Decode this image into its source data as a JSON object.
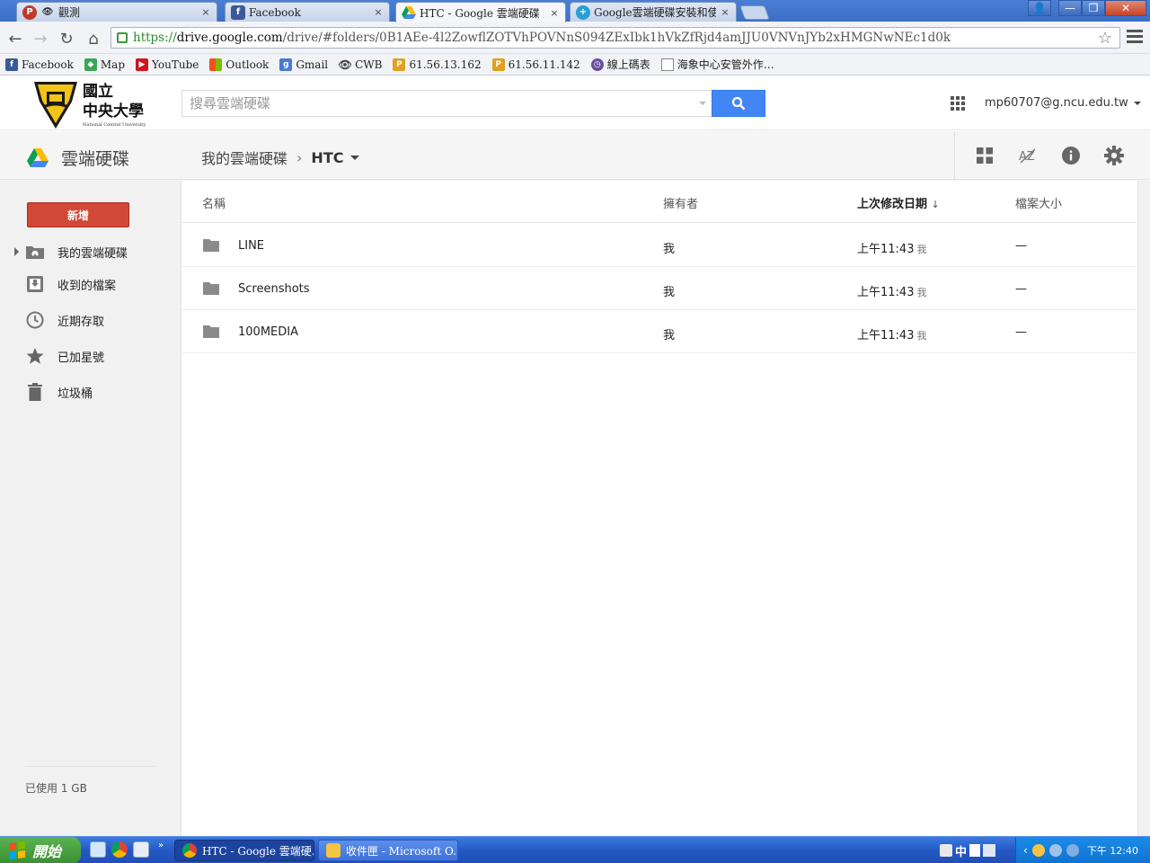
{
  "browser": {
    "tabs": [
      {
        "title": "觀測",
        "close": "×"
      },
      {
        "title": "Facebook",
        "close": "×"
      },
      {
        "title": "HTC - Google 雲端硬碟",
        "close": "×"
      },
      {
        "title": "Google雲端硬碟安裝和使用",
        "close": "×"
      }
    ],
    "url": {
      "scheme": "https://",
      "host": "drive.google.com",
      "path": "/drive/#folders/0B1AEe-4l2ZowflZOTVhPOVNnS094ZExIbk1hVkZfRjd4amJJU0VNVnJYb2xHMGNwNEc1d0k"
    },
    "bookmarks": [
      {
        "label": "Facebook",
        "icon": "facebook-icon",
        "color": "#3b5998"
      },
      {
        "label": "Map",
        "icon": "map-icon",
        "color": "#3aa757"
      },
      {
        "label": "YouTube",
        "icon": "youtube-icon",
        "color": "#cc181e"
      },
      {
        "label": "Outlook",
        "icon": "outlook-icon",
        "color": "#f25022"
      },
      {
        "label": "Gmail",
        "icon": "gmail-icon",
        "color": "#4a7bd4"
      },
      {
        "label": "CWB",
        "icon": "eye-icon",
        "color": "#555555"
      },
      {
        "label": "61.56.13.162",
        "icon": "pma-icon",
        "color": "#e0a020"
      },
      {
        "label": "61.56.11.142",
        "icon": "pma-icon",
        "color": "#e0a020"
      },
      {
        "label": "線上碼表",
        "icon": "stopwatch-icon",
        "color": "#6a4fa0"
      },
      {
        "label": "海象中心安管外作…",
        "icon": "page-icon",
        "color": "#ffffff"
      }
    ]
  },
  "drive": {
    "search_placeholder": "搜尋雲端硬碟",
    "account": "mp60707@g.ncu.edu.tw",
    "brand": "雲端硬碟",
    "breadcrumb": {
      "root": "我的雲端硬碟",
      "current": "HTC"
    },
    "new_button": "新增",
    "nav": [
      {
        "label": "我的雲端硬碟",
        "icon": "my-drive-icon"
      },
      {
        "label": "收到的檔案",
        "icon": "incoming-icon"
      },
      {
        "label": "近期存取",
        "icon": "clock-icon"
      },
      {
        "label": "已加星號",
        "icon": "star-icon"
      },
      {
        "label": "垃圾桶",
        "icon": "trash-icon"
      }
    ],
    "storage": "已使用 1 GB",
    "columns": {
      "name": "名稱",
      "owner": "擁有者",
      "modified": "上次修改日期",
      "sort_arrow": "↓",
      "size": "檔案大小"
    },
    "files": [
      {
        "name": "LINE",
        "owner": "我",
        "modified": "上午11:43",
        "modified_by": "我",
        "size": "—"
      },
      {
        "name": "Screenshots",
        "owner": "我",
        "modified": "上午11:43",
        "modified_by": "我",
        "size": "—"
      },
      {
        "name": "100MEDIA",
        "owner": "我",
        "modified": "上午11:43",
        "modified_by": "我",
        "size": "—"
      }
    ]
  },
  "taskbar": {
    "start": "開始",
    "tasks": [
      {
        "label": "HTC - Google 雲端硬..."
      },
      {
        "label": "收件匣 - Microsoft O..."
      }
    ],
    "ime": "中",
    "clock": "下午 12:40"
  },
  "colors": {
    "accent_blue": "#4285f4",
    "new_button_red": "#d14836",
    "taskbar_blue": "#2459c5"
  }
}
